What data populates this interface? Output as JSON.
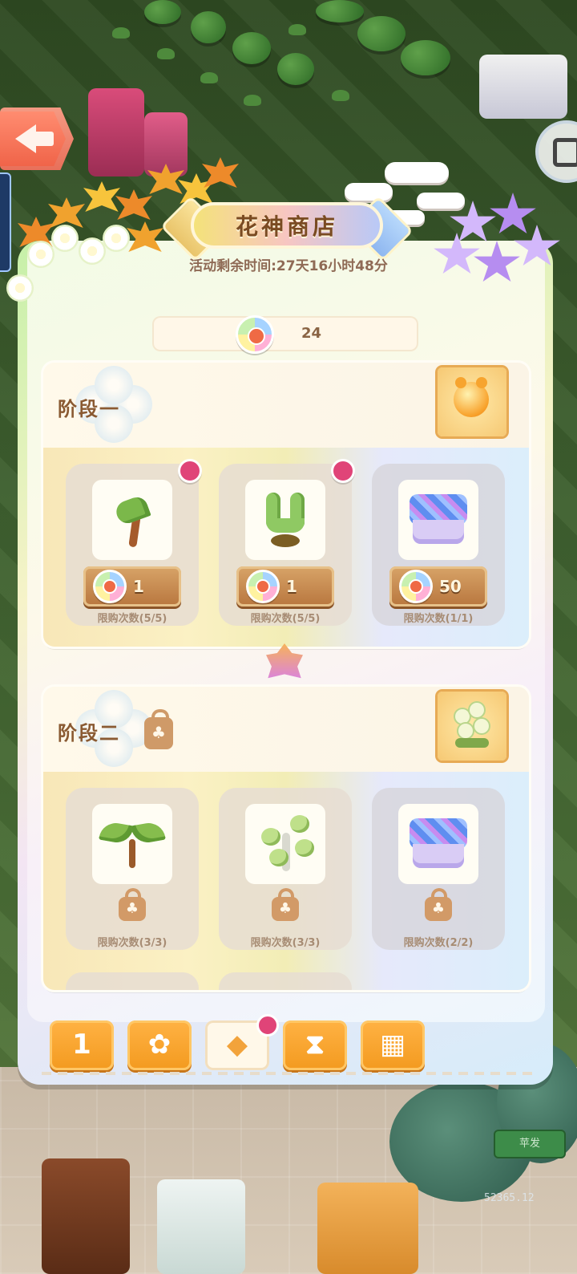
{
  "shop": {
    "title": "花神商店",
    "timer": "活动剩余时间:27天16小时48分",
    "currency": {
      "icon": "flower-token-icon",
      "value": "24"
    }
  },
  "stages": [
    {
      "title": "阶段一",
      "locked": false,
      "reward_icon": "golden-bear-orb-icon",
      "items": [
        {
          "name": "palm-sprout",
          "price": "1",
          "limit": "限购次数(5/5)",
          "has_dot": true
        },
        {
          "name": "cactus-plant",
          "price": "1",
          "limit": "限购次数(5/5)",
          "has_dot": true
        },
        {
          "name": "blue-ribbon-cake",
          "price": "50",
          "limit": "限购次数(1/1)",
          "has_dot": false
        }
      ]
    },
    {
      "title": "阶段二",
      "locked": true,
      "reward_icon": "white-flower-bonsai-icon",
      "items": [
        {
          "name": "green-sprout",
          "limit": "限购次数(3/3)"
        },
        {
          "name": "succulent-plant",
          "limit": "限购次数(3/3)"
        },
        {
          "name": "blue-ribbon-cake",
          "limit": "限购次数(2/2)"
        }
      ]
    }
  ],
  "tabs": [
    {
      "icon": "podium-rank-icon",
      "glyph": "1",
      "active": false
    },
    {
      "icon": "pinwheel-flower-icon",
      "glyph": "✿",
      "active": false
    },
    {
      "icon": "shop-bag-coins-icon",
      "glyph": "◆",
      "active": true,
      "has_dot": true
    },
    {
      "icon": "hourglass-icon",
      "glyph": "⧗",
      "active": false
    },
    {
      "icon": "gift-box-icon",
      "glyph": "▦",
      "active": false
    }
  ],
  "background": {
    "green_button": "苹发",
    "coin_readout": "52365.12"
  },
  "colors": {
    "accent_orange": "#f39a1f",
    "badge_red": "#e04478",
    "title_text": "#7a4b22",
    "price_wood": "#b8763e"
  }
}
